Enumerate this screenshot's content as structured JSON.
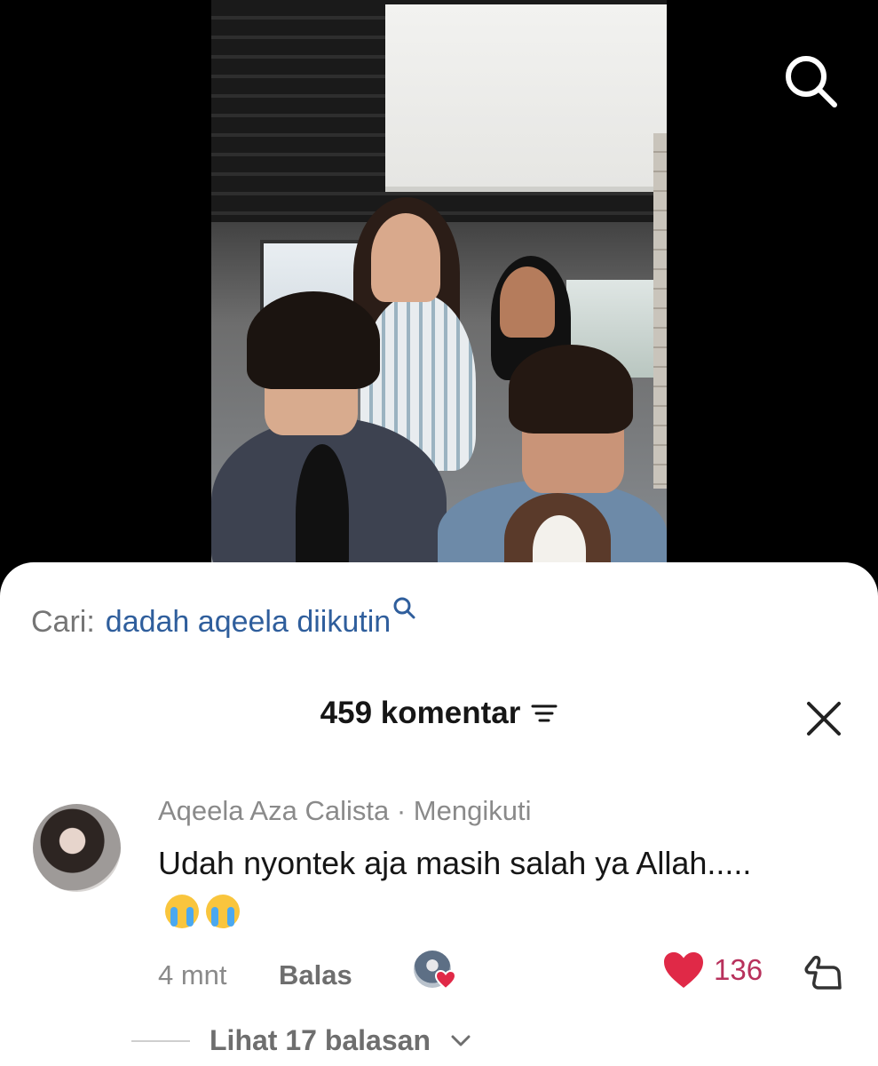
{
  "video": {
    "description": ""
  },
  "search_suggestion": {
    "prefix": "Cari:",
    "query": "dadah aqeela diikutin"
  },
  "comments": {
    "count_label": "459 komentar"
  },
  "comment": {
    "author": "Aqeela Aza Calista",
    "follow_status": "· Mengikuti",
    "text": "Udah nyontek aja masih salah ya Allah.....",
    "time": "4 mnt",
    "reply_label": "Balas",
    "like_count": "136",
    "view_replies_label": "Lihat 17 balasan"
  },
  "icons": {
    "top_search": "search-icon",
    "mini_search": "search-icon",
    "filter": "filter-icon",
    "close": "close-icon",
    "heart": "heart-icon",
    "dislike": "thumbs-down-icon",
    "chevron": "chevron-down-icon"
  },
  "colors": {
    "query_blue": "#2f5e9c",
    "like_red": "#e02947",
    "like_count": "#b8315c",
    "muted_text": "#8a8a8a"
  }
}
